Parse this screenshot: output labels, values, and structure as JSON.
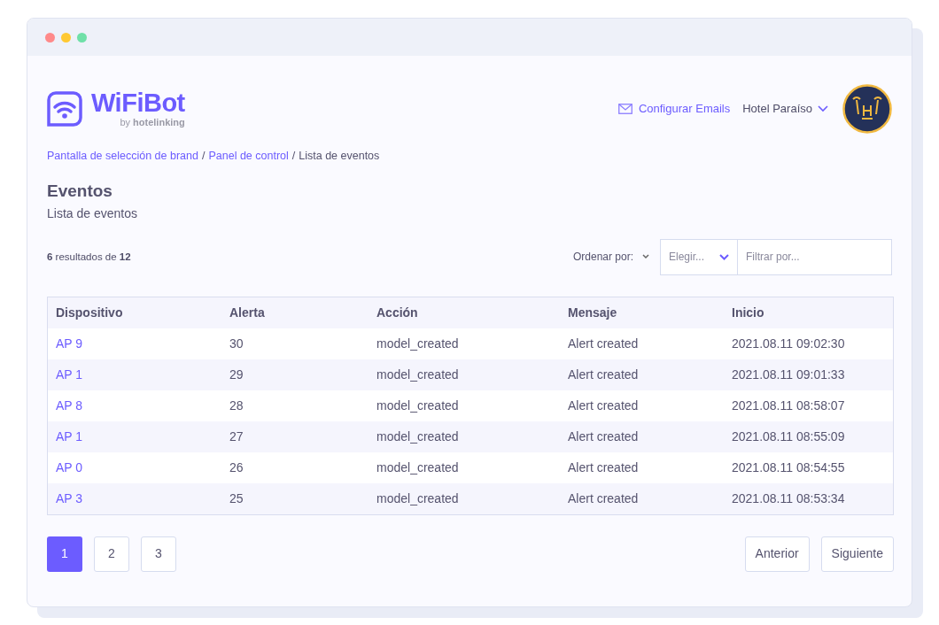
{
  "window": {
    "controls": [
      {
        "color": "#ff8a8a"
      },
      {
        "color": "#ffc933"
      },
      {
        "color": "#6fe0a8"
      }
    ]
  },
  "header": {
    "logo": {
      "name": "WiFiBot",
      "byline": "by **hotelinking**"
    },
    "email_link": "Configurar Emails",
    "hotel_selector": "Hotel Paraíso"
  },
  "breadcrumb": {
    "separator": "/",
    "items": [
      {
        "label": "Pantalla de selección de brand",
        "current": false
      },
      {
        "label": "Panel de control",
        "current": false
      },
      {
        "label": "Lista de eventos",
        "current": true
      }
    ]
  },
  "page": {
    "title": "Eventos",
    "subtitle": "Lista de eventos"
  },
  "toolbar": {
    "results": "**6** resultados de **12**",
    "sort_label": "Ordenar por:",
    "sort_select": "Elegir...",
    "filter": {
      "placeholder": "Filtrar por..."
    }
  },
  "table": {
    "columns": [
      "Dispositivo",
      "Alerta",
      "Acción",
      "Mensaje",
      "Inicio"
    ],
    "rows": [
      [
        "AP 9",
        "30",
        "model_created",
        "Alert created",
        "2021.08.11 09:02:30"
      ],
      [
        "AP 1",
        "29",
        "model_created",
        "Alert created",
        "2021.08.11 09:01:33"
      ],
      [
        "AP 8",
        "28",
        "model_created",
        "Alert created",
        "2021.08.11 08:58:07"
      ],
      [
        "AP 1",
        "27",
        "model_created",
        "Alert created",
        "2021.08.11 08:55:09"
      ],
      [
        "AP 0",
        "26",
        "model_created",
        "Alert created",
        "2021.08.11 08:54:55"
      ],
      [
        "AP 3",
        "25",
        "model_created",
        "Alert created",
        "2021.08.11 08:53:34"
      ]
    ]
  },
  "pagination": {
    "pages": [
      {
        "label": "1",
        "selected": true
      },
      {
        "label": "2",
        "selected": false
      },
      {
        "label": "3",
        "selected": false
      }
    ],
    "buttons": [
      "Anterior",
      "Siguiente"
    ]
  }
}
